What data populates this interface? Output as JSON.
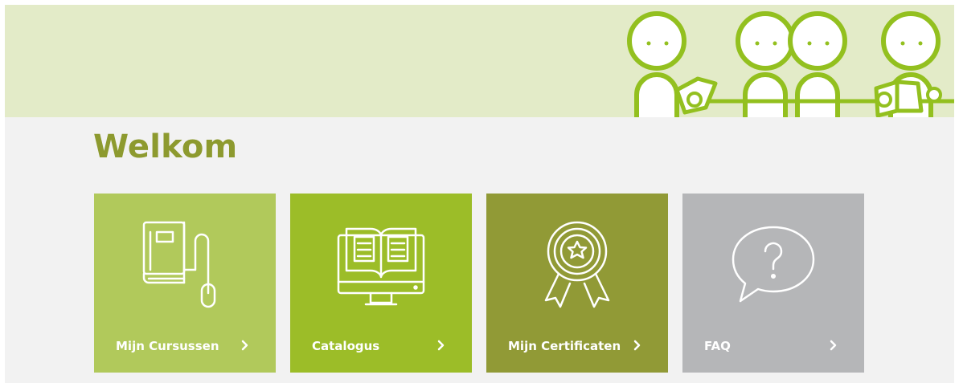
{
  "page": {
    "title": "Welkom"
  },
  "banner": {
    "illustration": "people-reading-illustration",
    "accent_color": "#93c01f",
    "background_color": "#e3ebc8"
  },
  "tiles": [
    {
      "label": "Mijn Cursussen",
      "icon": "book-mouse-icon",
      "color": "#b1c95b"
    },
    {
      "label": "Catalogus",
      "icon": "monitor-book-icon",
      "color": "#9cbd28"
    },
    {
      "label": "Mijn Certificaten",
      "icon": "award-ribbon-icon",
      "color": "#919a36"
    },
    {
      "label": "FAQ",
      "icon": "question-bubble-icon",
      "color": "#b5b6b8"
    }
  ]
}
